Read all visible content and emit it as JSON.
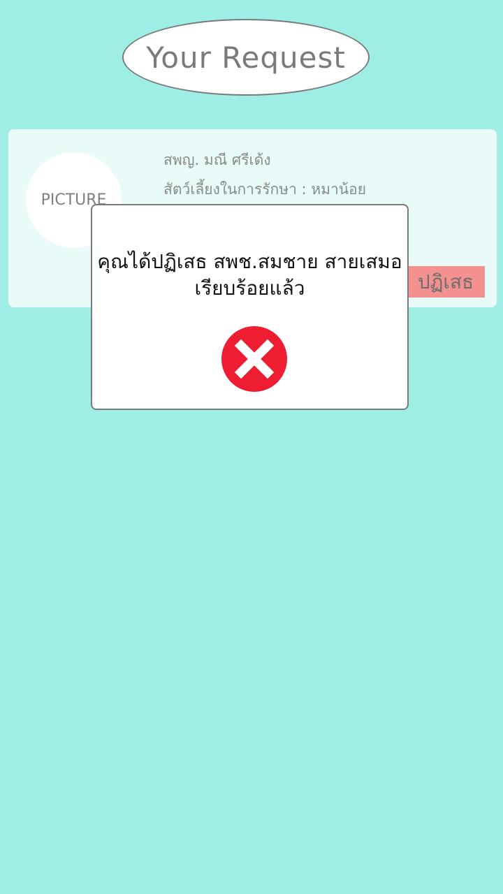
{
  "header": {
    "title": "Your Request"
  },
  "request_card": {
    "picture_label": "PICTURE",
    "name": "สพญ. มณี ศรีเด้ง",
    "pet_line": "สัตว์เลี้ยงในการรักษา : หมาน้อย",
    "reject_label": "ปฏิเสธ"
  },
  "dialog": {
    "message_line1": "คุณได้ปฏิเสธ สพช.สมชาย  สายเสมอ",
    "message_line2": "เรียบร้อยแล้ว",
    "icon": "error-x-icon"
  },
  "colors": {
    "background": "#9eeee6",
    "card": "#e8fbf9",
    "reject_button": "#f39191",
    "error_icon": "#ee1d31"
  }
}
